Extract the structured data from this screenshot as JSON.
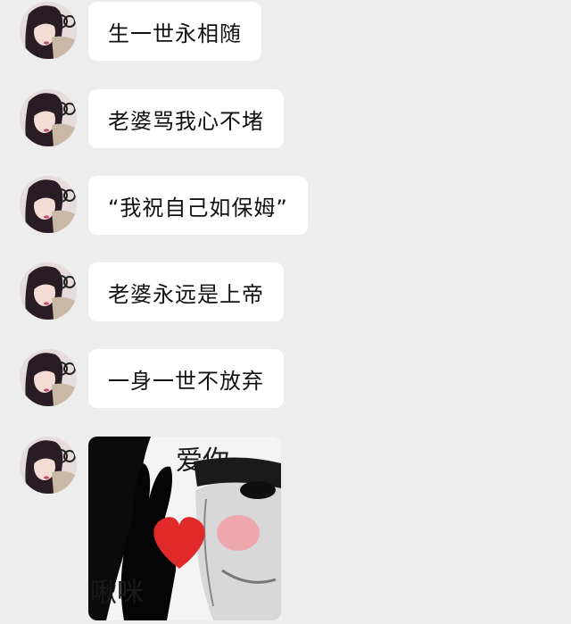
{
  "chat": {
    "messages": [
      {
        "type": "text",
        "text": "生一世永相随"
      },
      {
        "type": "text",
        "text": "老婆骂我心不堵"
      },
      {
        "type": "text",
        "text": "“我祝自己如保姆”"
      },
      {
        "type": "text",
        "text": "老婆永远是上帝"
      },
      {
        "type": "text",
        "text": "一身一世不放弃"
      }
    ],
    "sticker": {
      "top_text": "爱你",
      "bottom_text": "啾咪",
      "icon": "heart-icon",
      "heart_color": "#e02a2a"
    }
  },
  "colors": {
    "background": "#ededed",
    "bubble": "#ffffff",
    "text": "#111111"
  }
}
